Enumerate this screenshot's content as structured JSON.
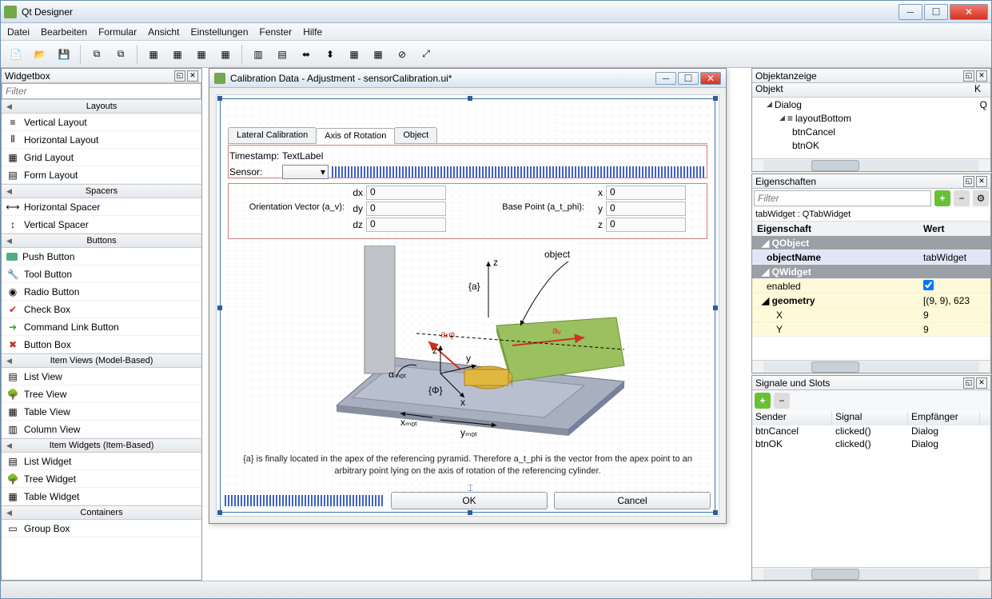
{
  "window": {
    "title": "Qt Designer"
  },
  "menu": [
    "Datei",
    "Bearbeiten",
    "Formular",
    "Ansicht",
    "Einstellungen",
    "Fenster",
    "Hilfe"
  ],
  "panels": {
    "widgetbox": "Widgetbox",
    "objects": "Objektanzeige",
    "properties": "Eigenschaften",
    "signals": "Signale und Slots"
  },
  "filter_placeholder": "Filter",
  "widgetbox": {
    "cats": {
      "layouts": "Layouts",
      "spacers": "Spacers",
      "buttons": "Buttons",
      "itemviews": "Item Views (Model-Based)",
      "itemwidgets": "Item Widgets (Item-Based)",
      "containers": "Containers"
    },
    "items": {
      "vlayout": "Vertical Layout",
      "hlayout": "Horizontal Layout",
      "glayout": "Grid Layout",
      "flayout": "Form Layout",
      "hspacer": "Horizontal Spacer",
      "vspacer": "Vertical Spacer",
      "pushbtn": "Push Button",
      "toolbtn": "Tool Button",
      "radio": "Radio Button",
      "check": "Check Box",
      "cmdlink": "Command Link Button",
      "btnbox": "Button Box",
      "listview": "List View",
      "treeview": "Tree View",
      "tableview": "Table View",
      "columnview": "Column View",
      "listw": "List Widget",
      "treew": "Tree Widget",
      "tablew": "Table Widget",
      "groupbox": "Group Box"
    }
  },
  "dialog": {
    "title": "Calibration Data - Adjustment - sensorCalibration.ui*",
    "tabs": {
      "lateral": "Lateral Calibration",
      "axis": "Axis of Rotation",
      "object": "Object"
    },
    "timestamp_lbl": "Timestamp:",
    "timestamp_val": "TextLabel",
    "sensor_lbl": "Sensor:",
    "orient_lbl": "Orientation Vector (a_v):",
    "base_lbl": "Base Point (a_t_phi):",
    "vec": {
      "dx": "dx",
      "dy": "dy",
      "dz": "dz",
      "x": "x",
      "y": "y",
      "z": "z"
    },
    "val": {
      "dx": "0",
      "dy": "0",
      "dz": "0",
      "x": "0",
      "y": "0",
      "z": "0"
    },
    "illus": {
      "object": "object",
      "z": "z",
      "a": "{a}",
      "atphi": "aₜφ",
      "av": "aᵥ",
      "phi": "{Φ}",
      "xmot": "xₘₒₜ",
      "ymot": "yₘₒₜ",
      "amot": "αₘₒₜ",
      "x": "x",
      "y": "y",
      "z2": "z"
    },
    "desc": "{a} is finally located in the apex of the referencing pyramid. Therefore a_t_phi is the vector from the apex point to an arbitrary point lying on the axis of rotation of the referencing cylinder.",
    "ok": "OK",
    "cancel": "Cancel"
  },
  "objtree": {
    "hdr_obj": "Objekt",
    "hdr_cls": "K",
    "items": {
      "dialog": "Dialog",
      "layoutBottom": "layoutBottom",
      "btnCancel": "btnCancel",
      "btnOK": "btnOK"
    },
    "cls": {
      "dialog": "Q"
    }
  },
  "props": {
    "class_line": "tabWidget : QTabWidget",
    "hdr_prop": "Eigenschaft",
    "hdr_val": "Wert",
    "qobject": "QObject",
    "objectName_k": "objectName",
    "objectName_v": "tabWidget",
    "qwidget": "QWidget",
    "enabled_k": "enabled",
    "geometry_k": "geometry",
    "geometry_v": "[(9, 9), 623",
    "x_k": "X",
    "x_v": "9",
    "y_k": "Y",
    "y_v": "9"
  },
  "signals": {
    "hdr": {
      "sender": "Sender",
      "signal": "Signal",
      "receiver": "Empfänger"
    },
    "rows": [
      {
        "sender": "btnCancel",
        "signal": "clicked()",
        "receiver": "Dialog"
      },
      {
        "sender": "btnOK",
        "signal": "clicked()",
        "receiver": "Dialog"
      }
    ]
  }
}
